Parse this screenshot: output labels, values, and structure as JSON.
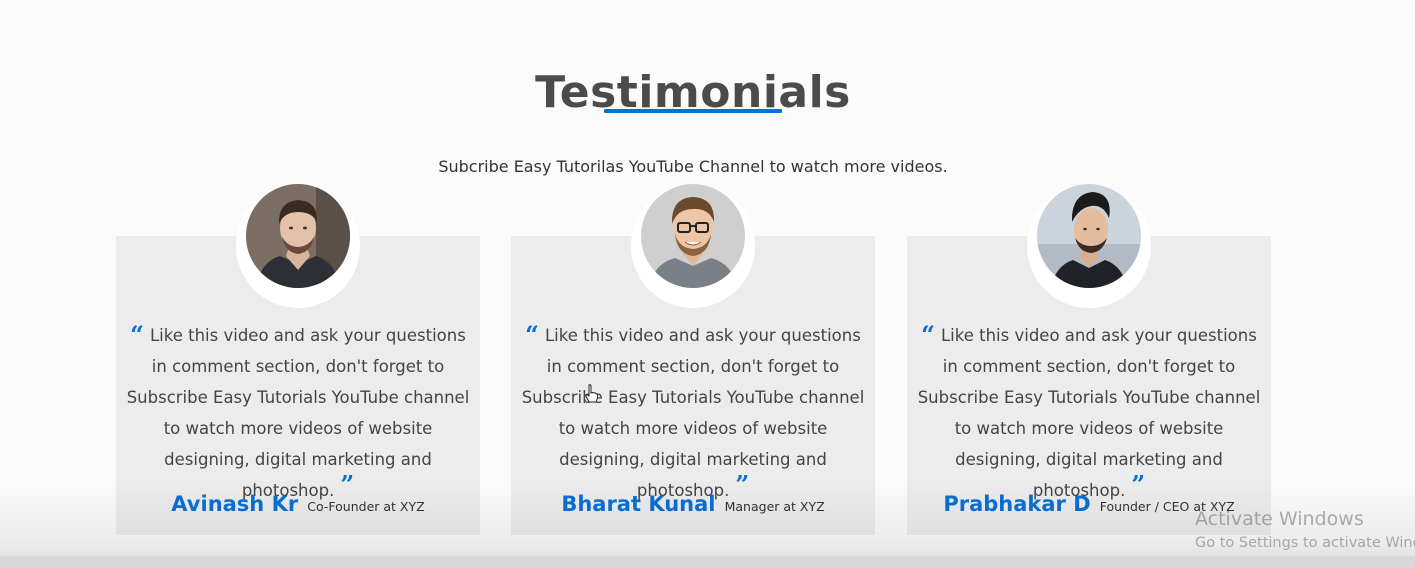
{
  "section": {
    "title": "Testimonials",
    "subtitle": "Subcribe Easy Tutorilas YouTube Channel to watch more videos."
  },
  "colors": {
    "accent": "#0a6fd4",
    "card_bg": "#ececec",
    "page_bg": "#fbfbfb"
  },
  "quote_icons": {
    "open": "open-quote-icon",
    "close": "close-quote-icon"
  },
  "testimonials": [
    {
      "quote": "Like this video and ask your questions in comment section, don't forget to Subscribe Easy Tutorials YouTube channel to watch more videos of website designing, digital marketing and photoshop.",
      "name": "Avinash Kr",
      "role": "Co-Founder at XYZ"
    },
    {
      "quote": "Like this video and ask your questions in comment section, don't forget to Subscribe Easy Tutorials YouTube channel to watch more videos of website designing, digital marketing and photoshop.",
      "name": "Bharat Kunal",
      "role": "Manager at XYZ"
    },
    {
      "quote": "Like this video and ask your questions in comment section, don't forget to Subscribe Easy Tutorials YouTube channel to watch more videos of website designing, digital marketing and photoshop.",
      "name": "Prabhakar D",
      "role": "Founder / CEO at XYZ"
    }
  ],
  "watermark": {
    "title": "Activate Windows",
    "subtitle": "Go to Settings to activate Windows."
  }
}
